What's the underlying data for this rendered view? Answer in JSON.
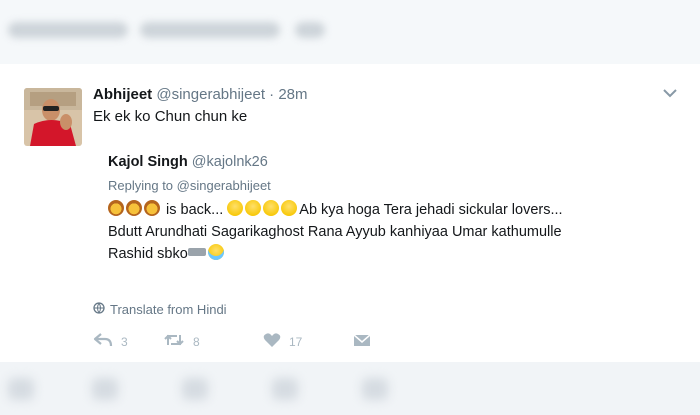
{
  "tweet": {
    "author": {
      "name": "Abhijeet",
      "handle": "@singerabhijeet",
      "separator": "·",
      "time": "28m"
    },
    "text": "Ek ek ko Chun chun ke",
    "quoted": {
      "name": "Kajol Singh",
      "handle": "@kajolnk26",
      "replying_to": "Replying to @singerabhijeet",
      "line1_part1": "is back...",
      "line1_part2": "Ab kya hoga Tera jehadi sickular lovers...",
      "line2": "Bdutt Arundhati Sagarikaghost Rana Ayyub kanhiyaa Umar kathumulle",
      "line3": "Rashid sbko"
    },
    "translate_label": "Translate from Hindi",
    "actions": {
      "reply_count": "3",
      "retweet_count": "8",
      "like_count": "17"
    }
  },
  "icons": {
    "caret": "chevron-down-icon",
    "translate": "globe-icon",
    "reply": "reply-icon",
    "retweet": "retweet-icon",
    "like": "heart-icon",
    "dm": "envelope-icon"
  },
  "colors": {
    "text": "#14171a",
    "secondary": "#657786",
    "action_gray": "#aab8c2"
  }
}
